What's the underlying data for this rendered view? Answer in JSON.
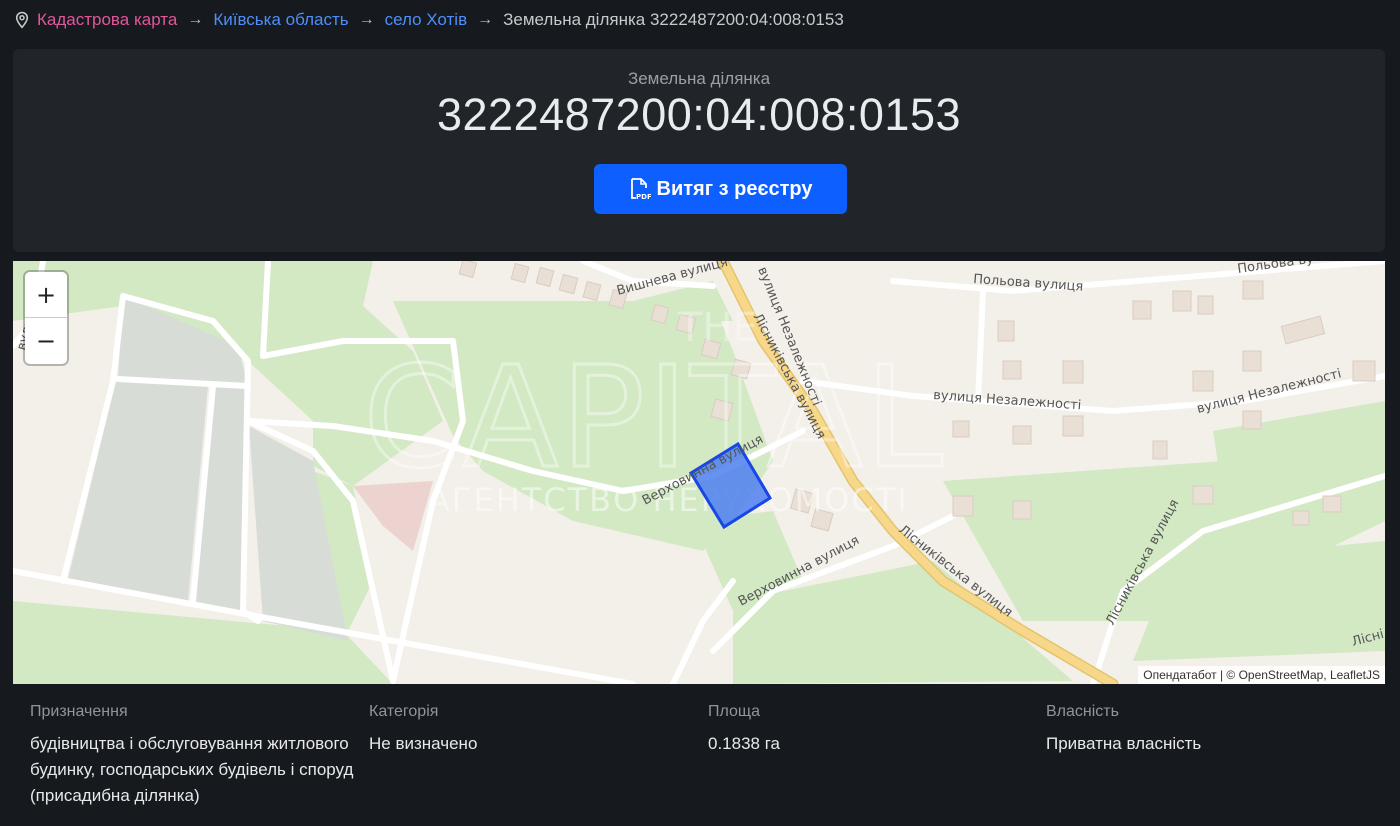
{
  "breadcrumb": {
    "items": [
      {
        "label": "Кадастрова карта"
      },
      {
        "label": "Київська область"
      },
      {
        "label": "село Хотів"
      },
      {
        "label": "Земельна ділянка 3222487200:04:008:0153"
      }
    ],
    "separator": "→"
  },
  "header": {
    "subtitle": "Земельна ділянка",
    "title": "3222487200:04:008:0153",
    "pdf_button_label": "Витяг з реєстру"
  },
  "map": {
    "zoom_in": "+",
    "zoom_out": "−",
    "attribution": "Опендатабот | © OpenStreetMap, LeafletJS",
    "street_labels": {
      "vyshneva": "Вишнева вулиця",
      "nezalezhnosti_v": "вулиця Незалежності",
      "polova": "Польова вулиця",
      "polova2": "Польова ву",
      "nezalezhnosti1": "вулиця Незалежності",
      "nezalezhnosti2": "вулиця Незалежності",
      "lisnykivska1": "Лісниківська вулиця",
      "lisnykivska2": "Лісниківська вулиця",
      "lisnykivska3": "Лісниківська вулиця",
      "lisn_edge": "Лісні",
      "verkhovynna1": "Верховинна вулиця",
      "verkhovynna2": "Верховинна вулиця",
      "left_edge": "вулиц"
    },
    "watermark": {
      "line1": "THE",
      "line2": "CAPITAL",
      "line3": "АГЕНТСТВО НЕРУХОМОСТІ"
    },
    "colors": {
      "parcel_fill": "#4d7ff0",
      "parcel_stroke": "#1747e6",
      "park": "#d3e9c4",
      "base": "#f3efe9",
      "main_road": "#f7d88a"
    }
  },
  "details": [
    {
      "label": "Призначення",
      "value": "будівництва і обслуговування житлового будинку, господарських будівель і споруд (присадибна ділянка)"
    },
    {
      "label": "Категорія",
      "value": "Не визначено"
    },
    {
      "label": "Площа",
      "value": "0.1838 га"
    },
    {
      "label": "Власність",
      "value": "Приватна власність"
    }
  ]
}
